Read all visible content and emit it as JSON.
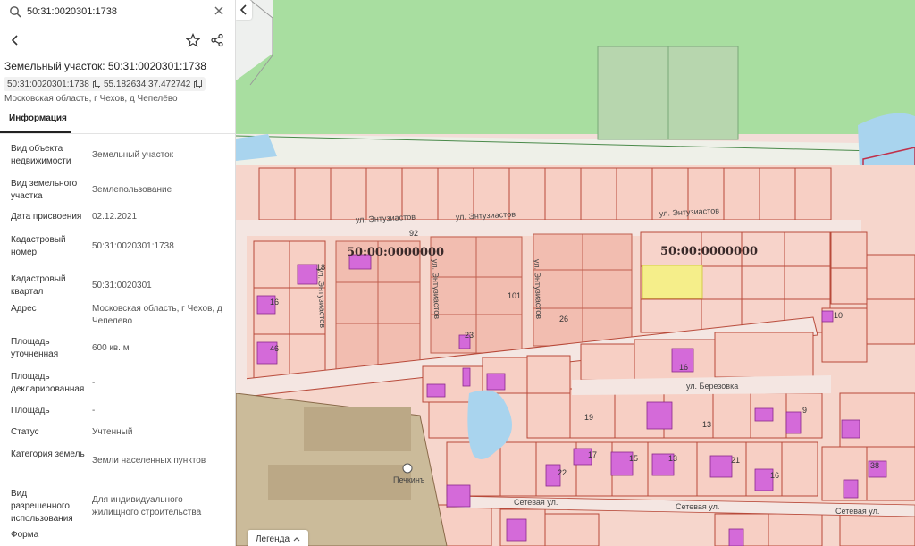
{
  "search": {
    "value": "50:31:0020301:1738"
  },
  "card": {
    "title": "Земельный участок: 50:31:0020301:1738",
    "cadastral_chip": "50:31:0020301:1738",
    "coords_chip": "55.182634 37.472742",
    "location": "Московская область, г Чехов, д Чепелёво",
    "tab": "Информация"
  },
  "info": [
    {
      "k": "Вид объекта недвижимости",
      "v": "Земельный участок"
    },
    {
      "k": "Вид земельного участка",
      "v": "Землепользование"
    },
    {
      "k": "Дата присвоения",
      "v": "02.12.2021"
    },
    {
      "k": "Кадастровый номер",
      "v": "50:31:0020301:1738"
    },
    {
      "k": "Кадастровый квартал",
      "v": "50:31:0020301"
    },
    {
      "k": "Адрес",
      "v": "Московская область, г Чехов, д Чепелево"
    },
    {
      "k": "Площадь уточненная",
      "v": "600 кв. м"
    },
    {
      "k": "Площадь декларированная",
      "v": "-"
    },
    {
      "k": "Площадь",
      "v": "-"
    },
    {
      "k": "Статус",
      "v": "Учтенный"
    },
    {
      "k": "Категория земель",
      "v": "Земли населенных пунктов"
    },
    {
      "k": "Вид разрешенного использования",
      "v": "Для индивидуального жилищного строительства"
    },
    {
      "k": "Форма",
      "v": ""
    }
  ],
  "map": {
    "streets": {
      "entuziastov_1": "ул. Энтузиастов",
      "entuziastov_2": "ул. Энтузиастов",
      "entuziastov_3": "ул. Энтузиастов",
      "entuziastov_v1": "ул. Энтузиастов",
      "entuziastov_v2": "ул. Энтузиастов",
      "entuziastov_v3": "ул. Энтузиастов",
      "berezovka": "ул. Березовка",
      "setevaya_1": "Сетевая ул.",
      "setevaya_2": "Сетевая ул.",
      "setevaya_3": "Сетевая ул."
    },
    "quarter_labels": [
      "50:00:0000000",
      "50:00:0000000"
    ],
    "numbers": [
      "92",
      "101",
      "26",
      "23",
      "16",
      "10",
      "19",
      "13",
      "9",
      "22",
      "18",
      "16",
      "17",
      "15",
      "16",
      "46",
      "38",
      "21",
      "13"
    ],
    "poi": "Печкинъ",
    "colors": {
      "parcel_fill": "#f7cfc4",
      "parcel_line": "#b84a3a",
      "forest": "#a8dea0",
      "water": "#a9d4ee",
      "building": "#d46ad9",
      "selected": "#f5ee8a",
      "industrial": "#cbbb9a"
    }
  },
  "legend": {
    "label": "Легенда"
  }
}
